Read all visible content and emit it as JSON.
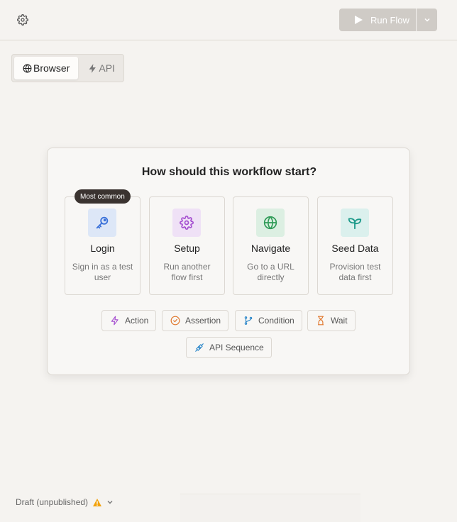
{
  "toolbar": {
    "settings_icon": "gear-icon",
    "run_label": "Run Flow",
    "run_icon": "play-icon",
    "menu_icon": "chevron-down-icon",
    "run_color": "#cfcbc6"
  },
  "mode": {
    "tabs": [
      {
        "label": "Browser",
        "icon": "globe-icon",
        "active": true
      },
      {
        "label": "API",
        "icon": "bolt-icon",
        "active": false
      }
    ]
  },
  "start": {
    "title": "How should this workflow start?",
    "badge": "Most common",
    "options": [
      {
        "label": "Login",
        "desc": "Sign in as a test user",
        "icon": "key-icon",
        "tile_color": "#dde7f7",
        "icon_color": "#3b72d9"
      },
      {
        "label": "Setup",
        "desc": "Run another flow first",
        "icon": "gear-icon",
        "tile_color": "#efe1f6",
        "icon_color": "#a54fd0"
      },
      {
        "label": "Navigate",
        "desc": "Go to a URL directly",
        "icon": "globe-icon",
        "tile_color": "#dcefe2",
        "icon_color": "#2f9b57"
      },
      {
        "label": "Seed Data",
        "desc": "Provision test data first",
        "icon": "sprout-icon",
        "tile_color": "#dbf0ed",
        "icon_color": "#1d9a8a"
      }
    ],
    "steps": [
      {
        "label": "Action",
        "icon": "bolt-icon",
        "icon_color": "#a54fd0"
      },
      {
        "label": "Assertion",
        "icon": "check-circle-icon",
        "icon_color": "#e0762b"
      },
      {
        "label": "Condition",
        "icon": "branch-icon",
        "icon_color": "#2a86c9"
      },
      {
        "label": "Wait",
        "icon": "hourglass-icon",
        "icon_color": "#e0762b"
      },
      {
        "label": "API Sequence",
        "icon": "plug-icon",
        "icon_color": "#2a86c9"
      }
    ]
  },
  "status": {
    "label": "Draft (unpublished)",
    "warning_icon": "warning-icon",
    "warning_color": "#f2a20c",
    "menu_icon": "chevron-down-icon"
  }
}
